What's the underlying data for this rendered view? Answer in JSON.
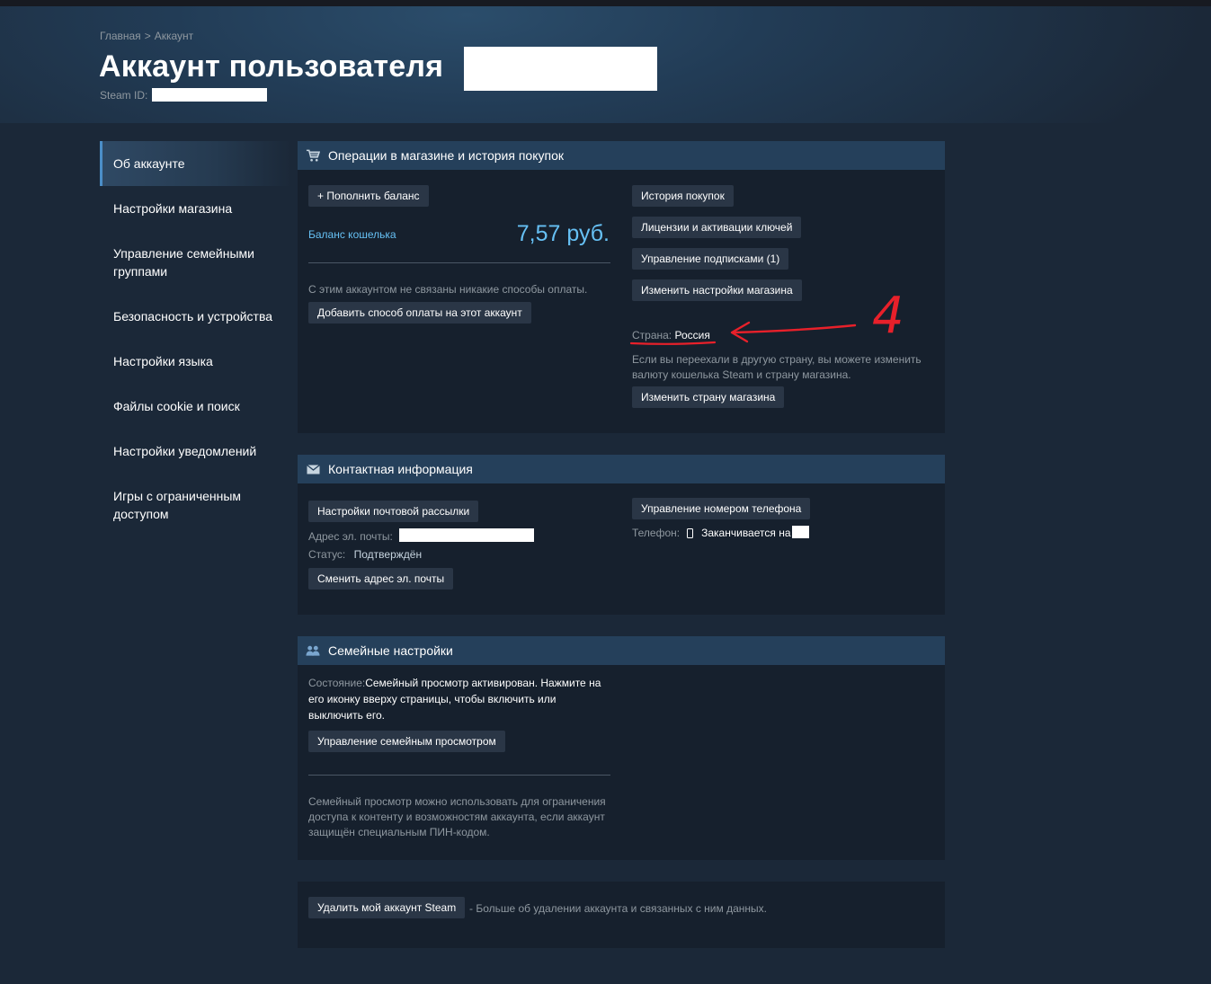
{
  "breadcrumb": {
    "home": "Главная",
    "separator": ">",
    "current": "Аккаунт"
  },
  "header": {
    "title": "Аккаунт пользователя",
    "steam_id_label": "Steam ID:"
  },
  "sidebar": {
    "items": [
      {
        "label": "Об аккаунте",
        "active": true
      },
      {
        "label": "Настройки магазина"
      },
      {
        "label": "Управление семейными группами"
      },
      {
        "label": "Безопасность и устройства"
      },
      {
        "label": "Настройки языка"
      },
      {
        "label": "Файлы cookie и поиск"
      },
      {
        "label": "Настройки уведомлений"
      },
      {
        "label": "Игры с ограниченным доступом"
      }
    ]
  },
  "store": {
    "title": "Операции в магазине и история покупок",
    "add_funds": "+ Пополнить баланс",
    "wallet_label": "Баланс кошелька",
    "wallet_value": "7,57 руб.",
    "no_payment": "С этим аккаунтом не связаны никакие способы оплаты.",
    "add_payment": "Добавить способ оплаты на этот аккаунт",
    "purchase_history": "История покупок",
    "licenses": "Лицензии и активации ключей",
    "subscriptions": "Управление подписками (1)",
    "store_prefs": "Изменить настройки магазина",
    "country_label": "Страна:",
    "country_value": "Россия",
    "moved_note": "Если вы переехали в другую страну, вы можете изменить валюту кошелька Steam и страну магазина.",
    "change_country": "Изменить страну магазина"
  },
  "annotation": {
    "text": "4",
    "color": "#e8202a"
  },
  "contact": {
    "title": "Контактная информация",
    "newsletter": "Настройки почтовой рассылки",
    "email_label": "Адрес эл. почты:",
    "status_label": "Статус:",
    "status_value": "Подтверждён",
    "change_email": "Сменить адрес эл. почты",
    "manage_phone": "Управление номером телефона",
    "phone_label": "Телефон:",
    "phone_value": "Заканчивается на"
  },
  "family": {
    "title": "Семейные настройки",
    "state_label": "Состояние:",
    "state_value": "Семейный просмотр активирован. Нажмите на его иконку вверху страницы, чтобы включить или выключить его.",
    "manage": "Управление семейным просмотром",
    "description": "Семейный просмотр можно использовать для ограничения доступа к контенту и возможностям аккаунта, если аккаунт защищён специальным ПИН-кодом."
  },
  "delete": {
    "button": "Удалить мой аккаунт Steam",
    "note": "- Больше об удалении аккаунта и связанных с ним данных."
  },
  "colors": {
    "accent": "#66c0f4",
    "background": "#1b2838",
    "panel": "#16202d",
    "header": "#25405b",
    "button": "#2a3646"
  }
}
